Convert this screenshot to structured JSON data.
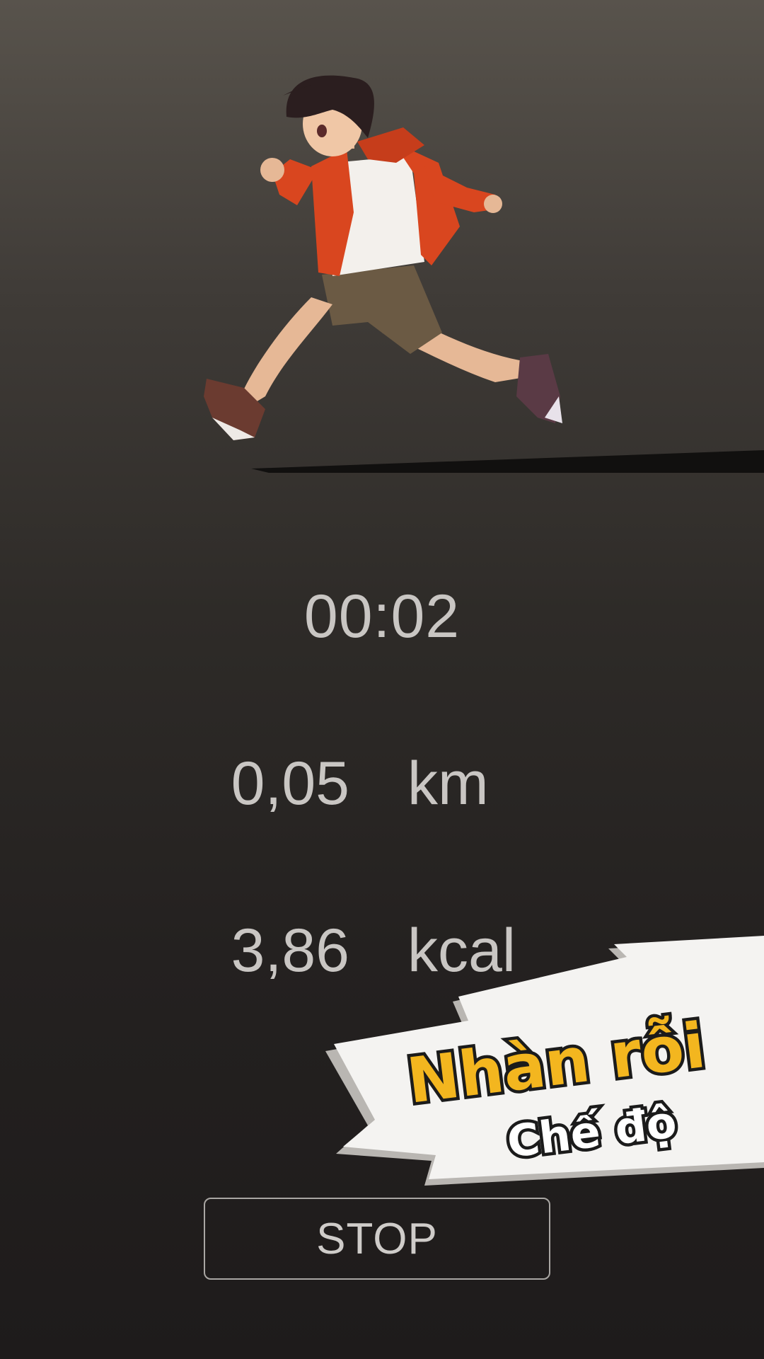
{
  "workout": {
    "timer": "00:02",
    "distance_value": "0,05",
    "distance_unit": "km",
    "calories_value": "3,86",
    "calories_unit": "kcal"
  },
  "controls": {
    "stop_label": "STOP"
  },
  "promo": {
    "line1": "Nhàn rỗi",
    "line2": "Chế độ",
    "title_color": "#f3b61f",
    "outline_color": "#1b1b1b"
  },
  "colors": {
    "background_top": "#58534c",
    "background_bottom": "#1e1b1b",
    "text": "#c9c6c3",
    "jacket": "#d9461f"
  },
  "icons": {
    "runner": "running-boy-illustration"
  }
}
